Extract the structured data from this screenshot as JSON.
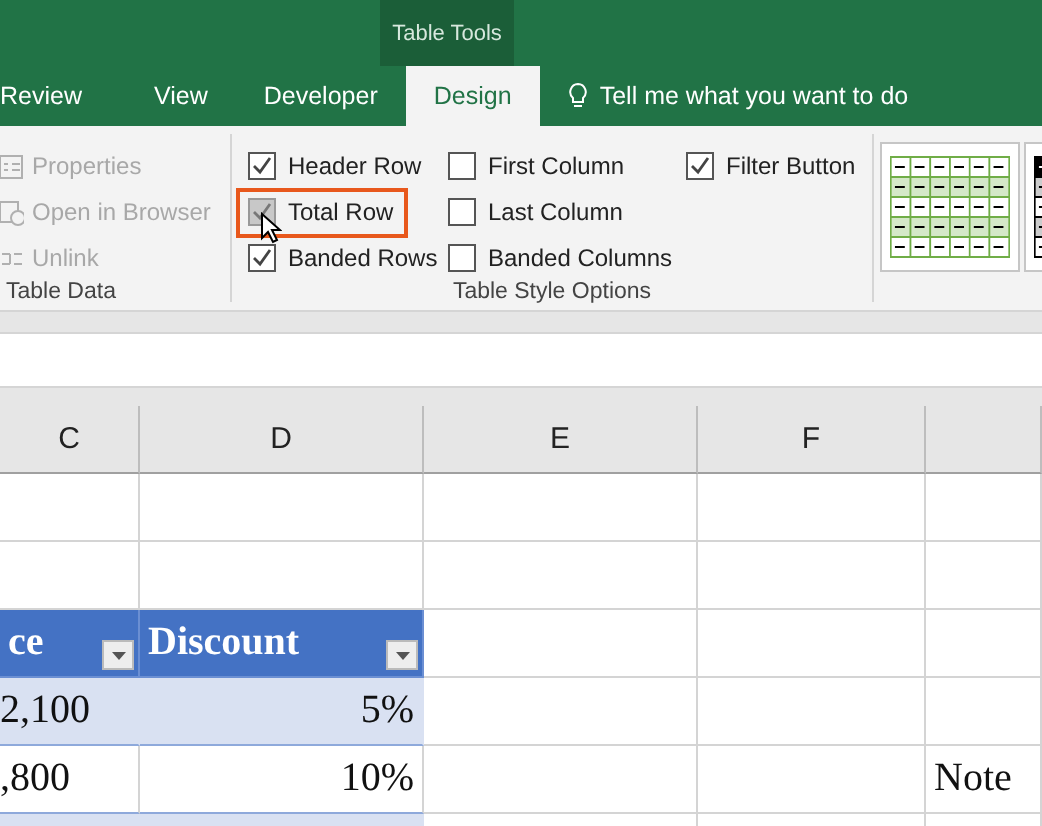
{
  "ribbon": {
    "context_title": "Table Tools",
    "tabs": [
      {
        "label": "Review",
        "selected": false
      },
      {
        "label": "View",
        "selected": false
      },
      {
        "label": "Developer",
        "selected": false
      },
      {
        "label": "Design",
        "selected": true
      }
    ],
    "tell_me": "Tell me what you want to do"
  },
  "table_data_group": {
    "label": "Table Data",
    "items": [
      {
        "label": "Properties",
        "disabled": true
      },
      {
        "label": "Open in Browser",
        "disabled": true
      },
      {
        "label": "Unlink",
        "disabled": true
      }
    ]
  },
  "table_style_options": {
    "label": "Table Style Options",
    "options": [
      {
        "label": "Header Row",
        "checked": true,
        "highlighted": false
      },
      {
        "label": "Total Row",
        "checked": true,
        "highlighted": true
      },
      {
        "label": "Banded Rows",
        "checked": true,
        "highlighted": false
      },
      {
        "label": "First Column",
        "checked": false,
        "highlighted": false
      },
      {
        "label": "Last Column",
        "checked": false,
        "highlighted": false
      },
      {
        "label": "Banded Columns",
        "checked": false,
        "highlighted": false
      },
      {
        "label": "Filter Button",
        "checked": true,
        "highlighted": false
      }
    ]
  },
  "sheet": {
    "columns": [
      "C",
      "D",
      "E",
      "F"
    ],
    "rows": [
      {
        "cells": [
          {
            "kind": "plain"
          },
          {
            "kind": "plain"
          },
          {
            "kind": "plain"
          },
          {
            "kind": "plain"
          },
          {
            "kind": "plain"
          }
        ]
      },
      {
        "cells": [
          {
            "kind": "plain"
          },
          {
            "kind": "plain"
          },
          {
            "kind": "plain"
          },
          {
            "kind": "plain"
          },
          {
            "kind": "plain"
          }
        ]
      },
      {
        "cells": [
          {
            "kind": "header",
            "text": "ce"
          },
          {
            "kind": "header",
            "text": "Discount"
          },
          {
            "kind": "plain"
          },
          {
            "kind": "plain"
          },
          {
            "kind": "plain"
          }
        ]
      },
      {
        "cells": [
          {
            "kind": "band",
            "text": "2,100"
          },
          {
            "kind": "band",
            "text": "5%"
          },
          {
            "kind": "plain"
          },
          {
            "kind": "plain"
          },
          {
            "kind": "plain"
          }
        ]
      },
      {
        "cells": [
          {
            "kind": "data",
            "text": ",800"
          },
          {
            "kind": "data",
            "text": "10%"
          },
          {
            "kind": "plain"
          },
          {
            "kind": "plain"
          },
          {
            "kind": "note",
            "text": "Note"
          }
        ]
      },
      {
        "cells": [
          {
            "kind": "band"
          },
          {
            "kind": "band"
          },
          {
            "kind": "plain"
          },
          {
            "kind": "plain"
          },
          {
            "kind": "plain"
          }
        ]
      }
    ]
  }
}
